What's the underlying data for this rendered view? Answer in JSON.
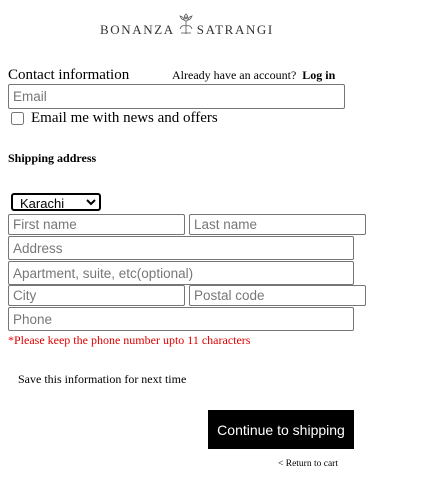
{
  "brand": {
    "left": "BONANZA",
    "right": "SATRANGI"
  },
  "contact": {
    "title": "Contact information",
    "account_prompt": "Already have an account?",
    "login_label": "Log in",
    "email_placeholder": "Email",
    "newsletter_label": "Email me with news and offers",
    "newsletter_checked": false
  },
  "shipping": {
    "title": "Shipping address",
    "city_selected": "Karachi",
    "first_name_placeholder": "First name",
    "last_name_placeholder": "Last name",
    "address_placeholder": "Address",
    "apartment_placeholder": "Apartment, suite, etc(optional)",
    "city_placeholder": "City",
    "postal_placeholder": "Postal code",
    "phone_placeholder": "Phone",
    "phone_error": "*Please keep the phone number upto 11 characters"
  },
  "save_info_label": "Save this information for next time",
  "continue_label": "Continue to shipping",
  "return_label": "< Return to cart",
  "colors": {
    "error": "#e00000",
    "button_bg": "#000000",
    "button_text": "#ffffff"
  }
}
